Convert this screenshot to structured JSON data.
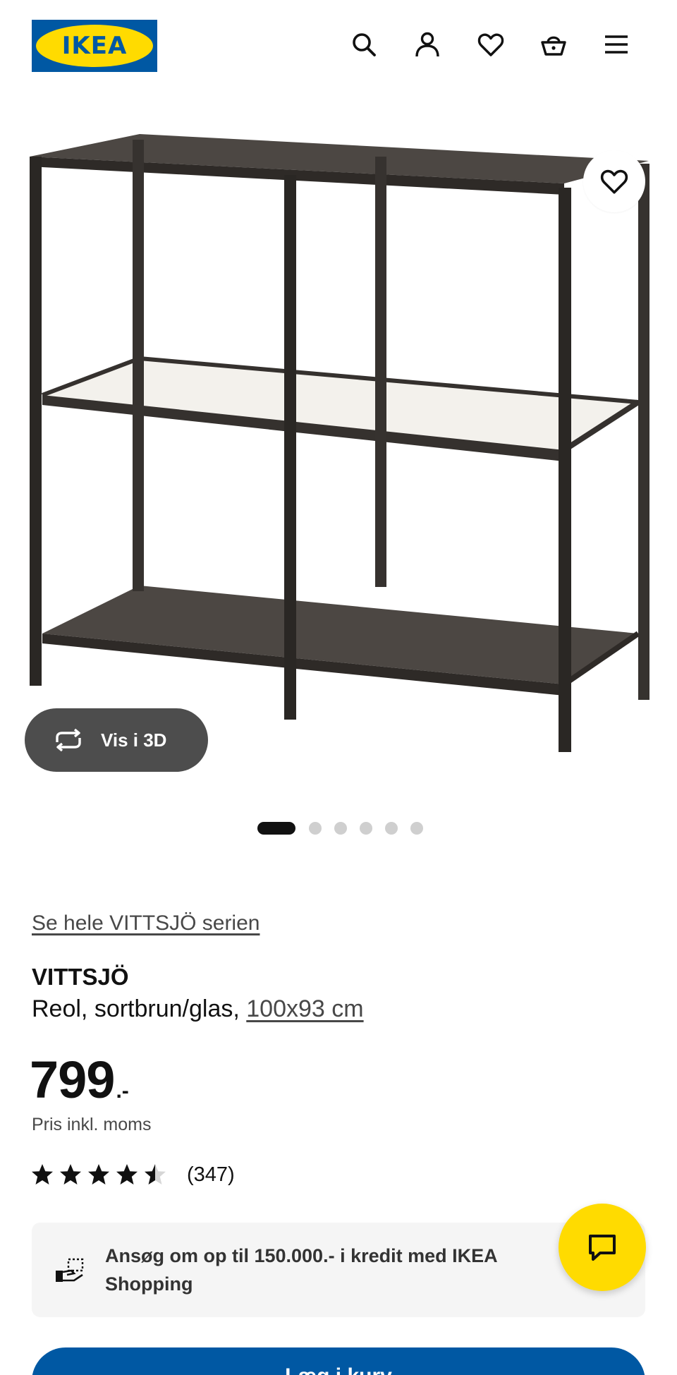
{
  "header": {
    "logo_text": "IKEA",
    "icons": [
      "search-icon",
      "user-icon",
      "heart-icon",
      "basket-icon",
      "menu-icon"
    ]
  },
  "gallery": {
    "view_3d_label": "Vis i 3D",
    "image_count": 6,
    "active_index": 0
  },
  "product": {
    "series_link": "Se hele VITTSJÖ serien",
    "name": "VITTSJÖ",
    "description": "Reol, sortbrun/glas,",
    "size_link": "100x93 cm",
    "price": "799",
    "price_suffix": ".-",
    "price_note": "Pris inkl. moms",
    "rating": 4.5,
    "rating_max": 5,
    "review_count": "(347)"
  },
  "credit": {
    "text": "Ansøg om op til 150.000.- i kredit med IKEA Shopping"
  },
  "cart": {
    "label": "Læg i kurv"
  },
  "colors": {
    "ikea_blue": "#0058a3",
    "ikea_yellow": "#ffdb00",
    "text": "#111111",
    "muted": "#484848",
    "pill_dark": "#4d4d4d",
    "box_bg": "#f5f5f5"
  }
}
